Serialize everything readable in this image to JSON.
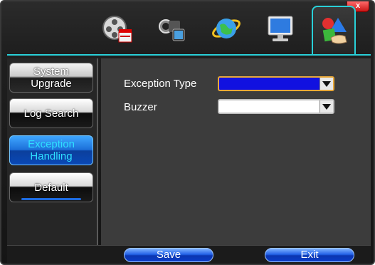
{
  "window": {
    "close_label": "x"
  },
  "toolbar": {
    "tabs": [
      {
        "icon": "film-clapper-icon"
      },
      {
        "icon": "video-camera-icon"
      },
      {
        "icon": "globe-network-icon"
      },
      {
        "icon": "monitor-icon"
      },
      {
        "icon": "tools-shapes-icon",
        "active": true
      }
    ]
  },
  "sidebar": {
    "items": [
      {
        "label": "System\nUpgrade"
      },
      {
        "label": "Log Search"
      },
      {
        "label": "Exception\nHandling",
        "active": true
      },
      {
        "label": "Default"
      }
    ]
  },
  "form": {
    "exception_type_label": "Exception Type",
    "exception_type_value": "",
    "buzzer_label": "Buzzer",
    "buzzer_value": ""
  },
  "footer": {
    "save_label": "Save",
    "exit_label": "Exit"
  },
  "colors": {
    "accent": "#29d0d8",
    "selected_field": "#1111e0",
    "button_blue": "#1c6fd9"
  }
}
